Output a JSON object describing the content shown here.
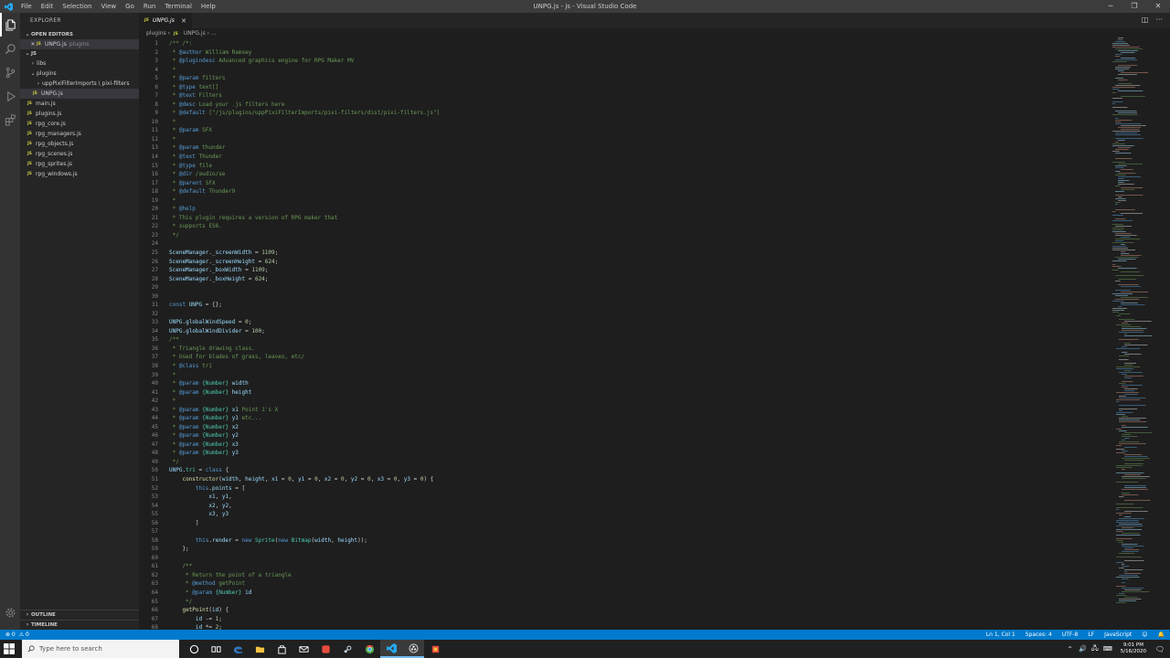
{
  "window": {
    "title": "UNPG.js - js - Visual Studio Code",
    "menu": [
      "File",
      "Edit",
      "Selection",
      "View",
      "Go",
      "Run",
      "Terminal",
      "Help"
    ],
    "controls": [
      "─",
      "❐",
      "✕"
    ]
  },
  "sidebar": {
    "title": "EXPLORER",
    "open_editors": {
      "label": "OPEN EDITORS",
      "items": [
        {
          "name": "UNPG.js",
          "detail": "plugins"
        }
      ]
    },
    "root": "JS",
    "tree": [
      {
        "label": "libs",
        "type": "folder",
        "depth": 1
      },
      {
        "label": "plugins",
        "type": "folder-open",
        "depth": 1
      },
      {
        "label": "uppPixiFilterImports \\ pixi-filters",
        "type": "folder",
        "depth": 2
      },
      {
        "label": "UNPG.js",
        "type": "file",
        "depth": 2,
        "selected": true
      },
      {
        "label": "main.js",
        "type": "file",
        "depth": 1
      },
      {
        "label": "plugins.js",
        "type": "file",
        "depth": 1
      },
      {
        "label": "rpg_core.js",
        "type": "file",
        "depth": 1
      },
      {
        "label": "rpg_managers.js",
        "type": "file",
        "depth": 1
      },
      {
        "label": "rpg_objects.js",
        "type": "file",
        "depth": 1
      },
      {
        "label": "rpg_scenes.js",
        "type": "file",
        "depth": 1
      },
      {
        "label": "rpg_sprites.js",
        "type": "file",
        "depth": 1
      },
      {
        "label": "rpg_windows.js",
        "type": "file",
        "depth": 1
      }
    ],
    "outline": "OUTLINE",
    "timeline": "TIMELINE"
  },
  "editor": {
    "tab": "UNPG.js",
    "breadcrumb": {
      "folder": "plugins",
      "file": "UNPG.js",
      "trail": "..."
    },
    "lines": [
      [
        [
          "c-com",
          "/** /*:"
        ]
      ],
      [
        [
          "c-com",
          " * "
        ],
        [
          "c-tag",
          "@author"
        ],
        [
          "c-com",
          " William Ramsey"
        ]
      ],
      [
        [
          "c-com",
          " * "
        ],
        [
          "c-tag",
          "@plugindesc"
        ],
        [
          "c-com",
          " Advanced graphics engine for RPG Maker MV"
        ]
      ],
      [
        [
          "c-com",
          " *"
        ]
      ],
      [
        [
          "c-com",
          " * "
        ],
        [
          "c-tag",
          "@param"
        ],
        [
          "c-com",
          " filters"
        ]
      ],
      [
        [
          "c-com",
          " * "
        ],
        [
          "c-tag",
          "@type"
        ],
        [
          "c-com",
          " text[]"
        ]
      ],
      [
        [
          "c-com",
          " * "
        ],
        [
          "c-tag",
          "@text"
        ],
        [
          "c-com",
          " Filters"
        ]
      ],
      [
        [
          "c-com",
          " * "
        ],
        [
          "c-tag",
          "@desc"
        ],
        [
          "c-com",
          " Load your .js filters here"
        ]
      ],
      [
        [
          "c-com",
          " * "
        ],
        [
          "c-tag",
          "@default"
        ],
        [
          "c-com",
          " [\"/js/plugins/uppPixiFilterImports/pixi-filters/dist/pixi-filters.js\"]"
        ]
      ],
      [
        [
          "c-com",
          " *"
        ]
      ],
      [
        [
          "c-com",
          " * "
        ],
        [
          "c-tag",
          "@param"
        ],
        [
          "c-com",
          " SFX"
        ]
      ],
      [
        [
          "c-com",
          " *"
        ]
      ],
      [
        [
          "c-com",
          " * "
        ],
        [
          "c-tag",
          "@param"
        ],
        [
          "c-com",
          " thunder"
        ]
      ],
      [
        [
          "c-com",
          " * "
        ],
        [
          "c-tag",
          "@text"
        ],
        [
          "c-com",
          " Thunder"
        ]
      ],
      [
        [
          "c-com",
          " * "
        ],
        [
          "c-tag",
          "@type"
        ],
        [
          "c-com",
          " file"
        ]
      ],
      [
        [
          "c-com",
          " * "
        ],
        [
          "c-tag",
          "@dir"
        ],
        [
          "c-com",
          " /audio/se"
        ]
      ],
      [
        [
          "c-com",
          " * "
        ],
        [
          "c-tag",
          "@parent"
        ],
        [
          "c-com",
          " SFX"
        ]
      ],
      [
        [
          "c-com",
          " * "
        ],
        [
          "c-tag",
          "@default"
        ],
        [
          "c-com",
          " Thunder9"
        ]
      ],
      [
        [
          "c-com",
          " *"
        ]
      ],
      [
        [
          "c-com",
          " * "
        ],
        [
          "c-tag",
          "@help"
        ]
      ],
      [
        [
          "c-com",
          " * This plugin requires a version of RPG maker that"
        ]
      ],
      [
        [
          "c-com",
          " * supports ES6."
        ]
      ],
      [
        [
          "c-com",
          " */"
        ]
      ],
      [],
      [
        [
          "c-var",
          "SceneManager"
        ],
        [
          "tx",
          "."
        ],
        [
          "c-var",
          "_screenWidth"
        ],
        [
          "tx",
          " = "
        ],
        [
          "c-num",
          "1109"
        ],
        [
          "tx",
          ";"
        ]
      ],
      [
        [
          "c-var",
          "SceneManager"
        ],
        [
          "tx",
          "."
        ],
        [
          "c-var",
          "_screenHeight"
        ],
        [
          "tx",
          " = "
        ],
        [
          "c-num",
          "624"
        ],
        [
          "tx",
          ";"
        ]
      ],
      [
        [
          "c-var",
          "SceneManager"
        ],
        [
          "tx",
          "."
        ],
        [
          "c-var",
          "_boxWidth"
        ],
        [
          "tx",
          " = "
        ],
        [
          "c-num",
          "1109"
        ],
        [
          "tx",
          ";"
        ]
      ],
      [
        [
          "c-var",
          "SceneManager"
        ],
        [
          "tx",
          "."
        ],
        [
          "c-var",
          "_boxHeight"
        ],
        [
          "tx",
          " = "
        ],
        [
          "c-num",
          "624"
        ],
        [
          "tx",
          ";"
        ]
      ],
      [],
      [],
      [
        [
          "c-kw",
          "const"
        ],
        [
          "tx",
          " "
        ],
        [
          "c-var",
          "UNPG"
        ],
        [
          "tx",
          " = {};"
        ]
      ],
      [],
      [
        [
          "c-var",
          "UNPG"
        ],
        [
          "tx",
          "."
        ],
        [
          "c-var",
          "globalWindSpeed"
        ],
        [
          "tx",
          " = "
        ],
        [
          "c-num",
          "0"
        ],
        [
          "tx",
          ";"
        ]
      ],
      [
        [
          "c-var",
          "UNPG"
        ],
        [
          "tx",
          "."
        ],
        [
          "c-var",
          "globalWindDivider"
        ],
        [
          "tx",
          " = "
        ],
        [
          "c-num",
          "100"
        ],
        [
          "tx",
          ";"
        ]
      ],
      [
        [
          "c-com",
          "/**"
        ]
      ],
      [
        [
          "c-com",
          " * Triangle drawing class."
        ]
      ],
      [
        [
          "c-com",
          " * Used for blades of grass, leaves, etc/"
        ]
      ],
      [
        [
          "c-com",
          " * "
        ],
        [
          "c-tag",
          "@class"
        ],
        [
          "c-com",
          " tri"
        ]
      ],
      [
        [
          "c-com",
          " *"
        ]
      ],
      [
        [
          "c-com",
          " * "
        ],
        [
          "c-tag",
          "@param"
        ],
        [
          "c-com",
          " "
        ],
        [
          "c-type",
          "{Number}"
        ],
        [
          "c-com",
          " "
        ],
        [
          "c-var",
          "width"
        ]
      ],
      [
        [
          "c-com",
          " * "
        ],
        [
          "c-tag",
          "@param"
        ],
        [
          "c-com",
          " "
        ],
        [
          "c-type",
          "{Number}"
        ],
        [
          "c-com",
          " "
        ],
        [
          "c-var",
          "height"
        ]
      ],
      [
        [
          "c-com",
          " *"
        ]
      ],
      [
        [
          "c-com",
          " * "
        ],
        [
          "c-tag",
          "@param"
        ],
        [
          "c-com",
          " "
        ],
        [
          "c-type",
          "{Number}"
        ],
        [
          "c-com",
          " "
        ],
        [
          "c-var",
          "x1"
        ],
        [
          "c-com",
          " Point 1's X"
        ]
      ],
      [
        [
          "c-com",
          " * "
        ],
        [
          "c-tag",
          "@param"
        ],
        [
          "c-com",
          " "
        ],
        [
          "c-type",
          "{Number}"
        ],
        [
          "c-com",
          " "
        ],
        [
          "c-var",
          "y1"
        ],
        [
          "c-com",
          " etc..."
        ]
      ],
      [
        [
          "c-com",
          " * "
        ],
        [
          "c-tag",
          "@param"
        ],
        [
          "c-com",
          " "
        ],
        [
          "c-type",
          "{Number}"
        ],
        [
          "c-com",
          " "
        ],
        [
          "c-var",
          "x2"
        ]
      ],
      [
        [
          "c-com",
          " * "
        ],
        [
          "c-tag",
          "@param"
        ],
        [
          "c-com",
          " "
        ],
        [
          "c-type",
          "{Number}"
        ],
        [
          "c-com",
          " "
        ],
        [
          "c-var",
          "y2"
        ]
      ],
      [
        [
          "c-com",
          " * "
        ],
        [
          "c-tag",
          "@param"
        ],
        [
          "c-com",
          " "
        ],
        [
          "c-type",
          "{Number}"
        ],
        [
          "c-com",
          " "
        ],
        [
          "c-var",
          "x3"
        ]
      ],
      [
        [
          "c-com",
          " * "
        ],
        [
          "c-tag",
          "@param"
        ],
        [
          "c-com",
          " "
        ],
        [
          "c-type",
          "{Number}"
        ],
        [
          "c-com",
          " "
        ],
        [
          "c-var",
          "y3"
        ]
      ],
      [
        [
          "c-com",
          " */"
        ]
      ],
      [
        [
          "c-var",
          "UNPG"
        ],
        [
          "tx",
          "."
        ],
        [
          "c-type",
          "tri"
        ],
        [
          "tx",
          " = "
        ],
        [
          "c-kw",
          "class"
        ],
        [
          "tx",
          " {"
        ]
      ],
      [
        [
          "tx",
          "    "
        ],
        [
          "c-fn",
          "constructor"
        ],
        [
          "tx",
          "("
        ],
        [
          "c-var",
          "width"
        ],
        [
          "tx",
          ", "
        ],
        [
          "c-var",
          "height"
        ],
        [
          "tx",
          ", "
        ],
        [
          "c-var",
          "x1"
        ],
        [
          "tx",
          " = "
        ],
        [
          "c-num",
          "0"
        ],
        [
          "tx",
          ", "
        ],
        [
          "c-var",
          "y1"
        ],
        [
          "tx",
          " = "
        ],
        [
          "c-num",
          "0"
        ],
        [
          "tx",
          ", "
        ],
        [
          "c-var",
          "x2"
        ],
        [
          "tx",
          " = "
        ],
        [
          "c-num",
          "0"
        ],
        [
          "tx",
          ", "
        ],
        [
          "c-var",
          "y2"
        ],
        [
          "tx",
          " = "
        ],
        [
          "c-num",
          "0"
        ],
        [
          "tx",
          ", "
        ],
        [
          "c-var",
          "x3"
        ],
        [
          "tx",
          " = "
        ],
        [
          "c-num",
          "0"
        ],
        [
          "tx",
          ", "
        ],
        [
          "c-var",
          "y3"
        ],
        [
          "tx",
          " = "
        ],
        [
          "c-num",
          "0"
        ],
        [
          "tx",
          ") {"
        ]
      ],
      [
        [
          "tx",
          "        "
        ],
        [
          "c-kw",
          "this"
        ],
        [
          "tx",
          "."
        ],
        [
          "c-var",
          "points"
        ],
        [
          "tx",
          " = ["
        ]
      ],
      [
        [
          "tx",
          "            "
        ],
        [
          "c-var",
          "x1"
        ],
        [
          "tx",
          ", "
        ],
        [
          "c-var",
          "y1"
        ],
        [
          "tx",
          ","
        ]
      ],
      [
        [
          "tx",
          "            "
        ],
        [
          "c-var",
          "x2"
        ],
        [
          "tx",
          ", "
        ],
        [
          "c-var",
          "y2"
        ],
        [
          "tx",
          ","
        ]
      ],
      [
        [
          "tx",
          "            "
        ],
        [
          "c-var",
          "x3"
        ],
        [
          "tx",
          ", "
        ],
        [
          "c-var",
          "y3"
        ]
      ],
      [
        [
          "tx",
          "        ]"
        ]
      ],
      [],
      [
        [
          "tx",
          "        "
        ],
        [
          "c-kw",
          "this"
        ],
        [
          "tx",
          "."
        ],
        [
          "c-var",
          "render"
        ],
        [
          "tx",
          " = "
        ],
        [
          "c-kw",
          "new"
        ],
        [
          "tx",
          " "
        ],
        [
          "c-type",
          "Sprite"
        ],
        [
          "tx",
          "("
        ],
        [
          "c-kw",
          "new"
        ],
        [
          "tx",
          " "
        ],
        [
          "c-type",
          "Bitmap"
        ],
        [
          "tx",
          "("
        ],
        [
          "c-var",
          "width"
        ],
        [
          "tx",
          ", "
        ],
        [
          "c-var",
          "height"
        ],
        [
          "tx",
          "));"
        ]
      ],
      [
        [
          "tx",
          "    };"
        ]
      ],
      [],
      [
        [
          "c-com",
          "    /**"
        ]
      ],
      [
        [
          "c-com",
          "     * Return the point of a triangle"
        ]
      ],
      [
        [
          "c-com",
          "     * "
        ],
        [
          "c-tag",
          "@method"
        ],
        [
          "c-com",
          " getPoint"
        ]
      ],
      [
        [
          "c-com",
          "     * "
        ],
        [
          "c-tag",
          "@param"
        ],
        [
          "c-com",
          " "
        ],
        [
          "c-type",
          "{Number}"
        ],
        [
          "c-com",
          " "
        ],
        [
          "c-var",
          "id"
        ]
      ],
      [
        [
          "c-com",
          "     */"
        ]
      ],
      [
        [
          "tx",
          "    "
        ],
        [
          "c-fn",
          "getPoint"
        ],
        [
          "tx",
          "("
        ],
        [
          "c-var",
          "id"
        ],
        [
          "tx",
          ") {"
        ]
      ],
      [
        [
          "tx",
          "        "
        ],
        [
          "c-var",
          "id"
        ],
        [
          "tx",
          " -= "
        ],
        [
          "c-num",
          "1"
        ],
        [
          "tx",
          ";"
        ]
      ],
      [
        [
          "tx",
          "        "
        ],
        [
          "c-var",
          "id"
        ],
        [
          "tx",
          " *= "
        ],
        [
          "c-num",
          "2"
        ],
        [
          "tx",
          ";"
        ]
      ]
    ]
  },
  "statusbar": {
    "left": [
      "⊗ 0",
      "⚠ 0"
    ],
    "right": [
      "Ln 1, Col 1",
      "Spaces: 4",
      "UTF-8",
      "LF",
      "JavaScript",
      "☺",
      "🔔"
    ]
  },
  "taskbar": {
    "search_placeholder": "Type here to search",
    "time": "9:01 PM",
    "date": "5/16/2020",
    "apps": [
      "cortana",
      "task-view",
      "edge",
      "file-explorer",
      "store",
      "mail",
      "app-red",
      "steam",
      "chrome",
      "vscode",
      "obs",
      "rpgmaker"
    ],
    "colors": {
      "edge": "#3277bc",
      "explorer": "#f5c342",
      "chrome": "#4caf50",
      "vscode": "#23a9f2",
      "red": "#e74c3c"
    }
  }
}
